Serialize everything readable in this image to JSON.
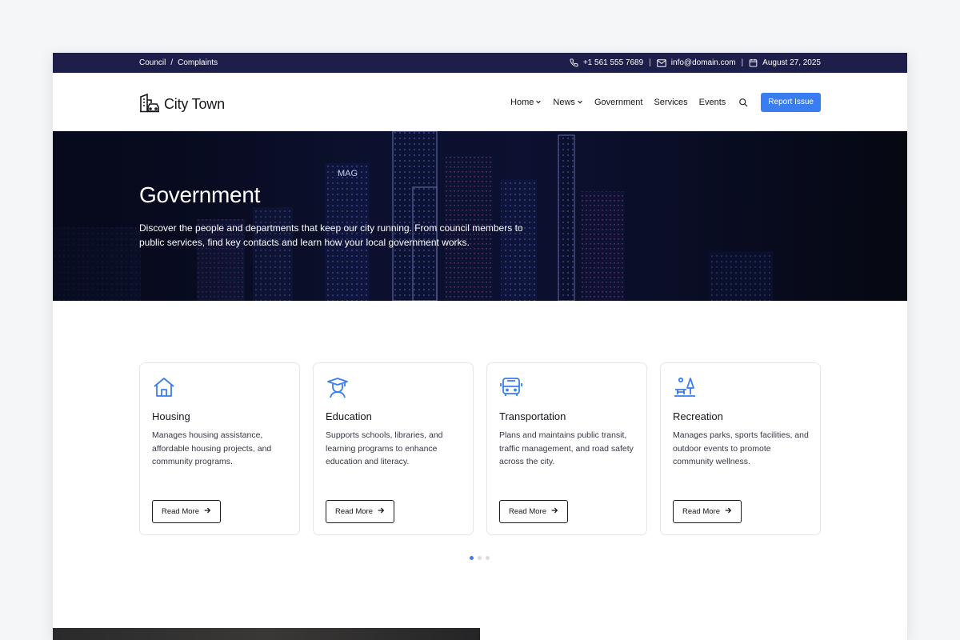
{
  "topbar": {
    "breadcrumbs": [
      "Council",
      "/",
      "Complaints"
    ],
    "phone": "+1 561 555 7689",
    "email": "info@domain.com",
    "date": "August 27, 2025",
    "separator": "|"
  },
  "nav": {
    "logo_text": "City Town",
    "items": [
      {
        "label": "Home",
        "dropdown": true
      },
      {
        "label": "News",
        "dropdown": true
      },
      {
        "label": "Government",
        "dropdown": false
      },
      {
        "label": "Services",
        "dropdown": false
      },
      {
        "label": "Events",
        "dropdown": false
      }
    ],
    "report_label": "Report Issue"
  },
  "hero": {
    "sign": "MAG",
    "title": "Government",
    "text": "Discover the people and departments that keep our city running. From council members to public services, find key contacts and learn how your local government works."
  },
  "cards": [
    {
      "icon": "house-icon",
      "title": "Housing",
      "desc": "Manages housing assistance, affordable housing projects, and community programs.",
      "button": "Read More"
    },
    {
      "icon": "graduate-icon",
      "title": "Education",
      "desc": "Supports schools, libraries, and learning programs to enhance education and literacy.",
      "button": "Read More"
    },
    {
      "icon": "bus-icon",
      "title": "Transportation",
      "desc": "Plans and maintains public transit, traffic management, and road safety across the city.",
      "button": "Read More"
    },
    {
      "icon": "park-icon",
      "title": "Recreation",
      "desc": "Manages parks, sports facilities, and outdoor events to promote community wellness.",
      "button": "Read More"
    }
  ],
  "carousel": {
    "count": 3,
    "active": 0
  },
  "colors": {
    "topbar": "#1d1f4a",
    "accent": "#3a7df0"
  }
}
